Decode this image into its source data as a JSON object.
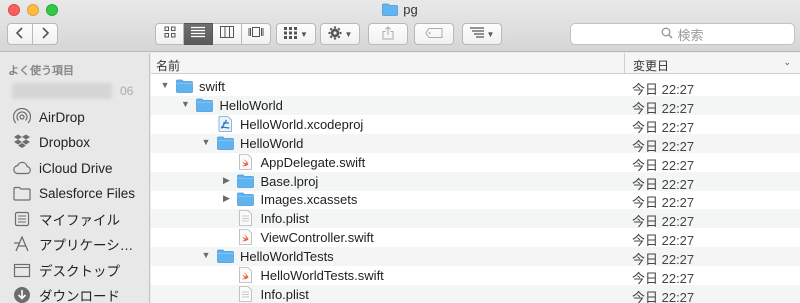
{
  "window": {
    "title": "pg"
  },
  "toolbar": {
    "search_placeholder": "検索"
  },
  "sidebar": {
    "heading": "よく使う項目",
    "blurred_suffix": "06",
    "items": [
      {
        "label": "AirDrop",
        "icon": "airdrop-icon"
      },
      {
        "label": "Dropbox",
        "icon": "dropbox-icon"
      },
      {
        "label": "iCloud Drive",
        "icon": "cloud-icon"
      },
      {
        "label": "Salesforce Files",
        "icon": "folder-icon"
      },
      {
        "label": "マイファイル",
        "icon": "all-files-icon"
      },
      {
        "label": "アプリケーシ…",
        "icon": "applications-icon"
      },
      {
        "label": "デスクトップ",
        "icon": "desktop-icon"
      },
      {
        "label": "ダウンロード",
        "icon": "downloads-icon"
      }
    ]
  },
  "list": {
    "col_name": "名前",
    "col_date": "変更日",
    "rows": [
      {
        "name": "swift",
        "date": "今日 22:27",
        "type": "folder",
        "disclosure": "open",
        "level": 0
      },
      {
        "name": "HelloWorld",
        "date": "今日 22:27",
        "type": "folder",
        "disclosure": "open",
        "level": 1
      },
      {
        "name": "HelloWorld.xcodeproj",
        "date": "今日 22:27",
        "type": "xcodeproj",
        "disclosure": "none",
        "level": 2
      },
      {
        "name": "HelloWorld",
        "date": "今日 22:27",
        "type": "folder",
        "disclosure": "open",
        "level": 2
      },
      {
        "name": "AppDelegate.swift",
        "date": "今日 22:27",
        "type": "swift",
        "disclosure": "none",
        "level": 3
      },
      {
        "name": "Base.lproj",
        "date": "今日 22:27",
        "type": "folder",
        "disclosure": "closed",
        "level": 3
      },
      {
        "name": "Images.xcassets",
        "date": "今日 22:27",
        "type": "folder",
        "disclosure": "closed",
        "level": 3
      },
      {
        "name": "Info.plist",
        "date": "今日 22:27",
        "type": "plist",
        "disclosure": "none",
        "level": 3
      },
      {
        "name": "ViewController.swift",
        "date": "今日 22:27",
        "type": "swift",
        "disclosure": "none",
        "level": 3
      },
      {
        "name": "HelloWorldTests",
        "date": "今日 22:27",
        "type": "folder",
        "disclosure": "open",
        "level": 2
      },
      {
        "name": "HelloWorldTests.swift",
        "date": "今日 22:27",
        "type": "swift",
        "disclosure": "none",
        "level": 3
      },
      {
        "name": "Info.plist",
        "date": "今日 22:27",
        "type": "plist",
        "disclosure": "none",
        "level": 3
      }
    ]
  },
  "colors": {
    "folder": "#5fb3f0",
    "swift": "#e8613a",
    "selected_view": "#616161"
  }
}
